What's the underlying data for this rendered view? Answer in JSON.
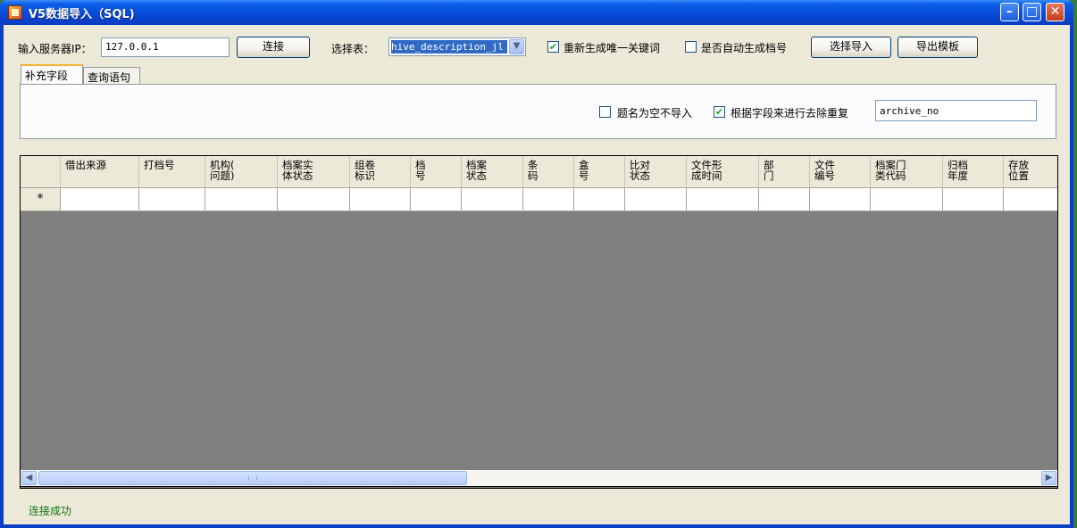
{
  "window": {
    "title": "V5数据导入（SQL)"
  },
  "toolbar": {
    "server_ip_label": "输入服务器IP：",
    "server_ip_value": "127.0.0.1",
    "connect_label": "连接",
    "select_table_label": "选择表：",
    "table_selected": "hive_description_jl",
    "regen_unique_key_label": "重新生成唯一关键词",
    "regen_unique_key_checked": true,
    "auto_archive_no_label": "是否自动生成档号",
    "auto_archive_no_checked": false,
    "select_import_label": "选择导入",
    "export_template_label": "导出模板"
  },
  "tabs": [
    {
      "label": "补充字段",
      "active": true
    },
    {
      "label": "查询语句",
      "active": false
    }
  ],
  "supplement": {
    "skip_empty_title_label": "题名为空不导入",
    "skip_empty_title_checked": false,
    "dedupe_by_field_label": "根据字段来进行去除重复",
    "dedupe_by_field_checked": true,
    "dedupe_field_value": "archive_no"
  },
  "grid": {
    "new_row_marker": "*",
    "columns": [
      "借出来源",
      "打档号",
      "机构(\n问题)",
      "档案实\n体状态",
      "组卷\n标识",
      "档\n号",
      "档案\n状态",
      "条\n码",
      "盒\n号",
      "比对\n状态",
      "文件形\n成时间",
      "部\n门",
      "文件\n编号",
      "档案门\n类代码",
      "归档\n年度",
      "存放\n位置"
    ]
  },
  "status": {
    "text": "连接成功"
  },
  "colors": {
    "titlebar": "#0a5fe6",
    "status_text": "#0f7a0f",
    "grid_empty": "#808080",
    "selection": "#316ac5"
  }
}
